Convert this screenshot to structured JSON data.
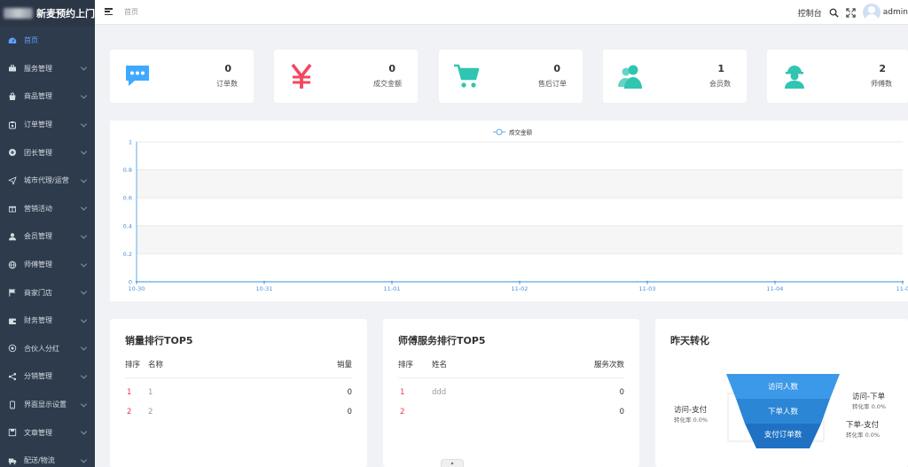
{
  "app": {
    "logo_text": "新麦预约上门"
  },
  "header": {
    "breadcrumb": "首页",
    "console_label": "控制台",
    "username": "admin"
  },
  "sidebar": {
    "items": [
      {
        "label": "首页",
        "icon": "dashboard-icon",
        "active": true
      },
      {
        "label": "服务管理",
        "icon": "toolbox-icon"
      },
      {
        "label": "商品管理",
        "icon": "shopping-bag-icon"
      },
      {
        "label": "订单管理",
        "icon": "clipboard-icon"
      },
      {
        "label": "团长管理",
        "icon": "plus-circle-icon"
      },
      {
        "label": "城市代理/运营",
        "icon": "send-icon"
      },
      {
        "label": "营销活动",
        "icon": "gift-icon"
      },
      {
        "label": "会员管理",
        "icon": "user-icon"
      },
      {
        "label": "师傅管理",
        "icon": "globe-icon"
      },
      {
        "label": "商家门店",
        "icon": "flag-icon"
      },
      {
        "label": "财务管理",
        "icon": "wallet-icon"
      },
      {
        "label": "合伙人分红",
        "icon": "target-icon"
      },
      {
        "label": "分销管理",
        "icon": "share-icon"
      },
      {
        "label": "界面显示设置",
        "icon": "mobile-icon"
      },
      {
        "label": "文章管理",
        "icon": "save-icon"
      },
      {
        "label": "配送/物流",
        "icon": "truck-icon"
      }
    ]
  },
  "stats": [
    {
      "value": "0",
      "label": "订单数",
      "icon": "chat-bubble-icon",
      "color": "#40a9ff"
    },
    {
      "value": "0",
      "label": "成交金额",
      "icon": "yen-icon",
      "color": "#f5475f"
    },
    {
      "value": "0",
      "label": "售后订单",
      "icon": "cart-icon",
      "color": "#2fc5b1"
    },
    {
      "value": "1",
      "label": "会员数",
      "icon": "users-icon",
      "color": "#2fc5b1"
    },
    {
      "value": "2",
      "label": "师傅数",
      "icon": "worker-icon",
      "color": "#2fc5b1"
    }
  ],
  "chart_data": {
    "type": "line",
    "legend": "成交金额",
    "legend_position": "top",
    "x": [
      "10-30",
      "10-31",
      "11-01",
      "11-02",
      "11-03",
      "11-04",
      "11-0"
    ],
    "series": [
      {
        "name": "成交金额",
        "values": [
          0,
          0,
          0,
          0,
          0,
          0,
          0
        ]
      }
    ],
    "y_ticks": [
      "0",
      "0.2",
      "0.4",
      "0.6",
      "0.8",
      "1"
    ],
    "ylim": [
      0,
      1
    ],
    "grid": true,
    "color": "#5fa8e8"
  },
  "sales_top5": {
    "title": "销量排行TOP5",
    "headers": {
      "rank": "排序",
      "name": "名称",
      "sales": "销量"
    },
    "rows": [
      {
        "rank": "1",
        "name": "1",
        "sales": "0"
      },
      {
        "rank": "2",
        "name": "2",
        "sales": "0"
      }
    ]
  },
  "master_top5": {
    "title": "师傅服务排行TOP5",
    "headers": {
      "rank": "排序",
      "name": "姓名",
      "count": "服务次数"
    },
    "rows": [
      {
        "rank": "1",
        "name": "ddd",
        "count": "0"
      },
      {
        "rank": "2",
        "name": "",
        "count": "0"
      }
    ]
  },
  "conversion": {
    "title": "昨天转化",
    "funnel": [
      "访问人数",
      "下单人数",
      "支付订单数"
    ],
    "left": {
      "label": "访问-支付",
      "rate": "转化率 0.0%"
    },
    "right_top": {
      "label": "访问-下单",
      "rate": "转化率 0.0%"
    },
    "right_bottom": {
      "label": "下单-支付",
      "rate": "转化率 0.0%"
    }
  }
}
